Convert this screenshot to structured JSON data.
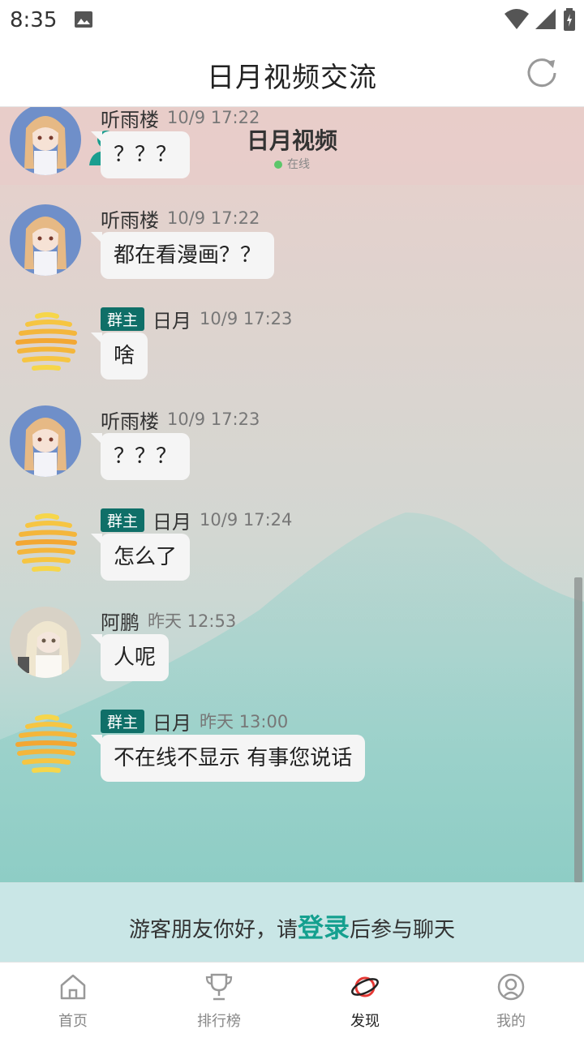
{
  "status": {
    "time": "8:35"
  },
  "header": {
    "title": "日月视频交流"
  },
  "group": {
    "name": "日月视频",
    "status": "在线"
  },
  "messages": [
    {
      "sender": "听雨楼",
      "badge": "",
      "time": "10/9 17:22",
      "text": "？？？",
      "avatar": "anime-girl"
    },
    {
      "sender": "听雨楼",
      "badge": "",
      "time": "10/9 17:22",
      "text": "都在看漫画？？",
      "avatar": "anime-girl"
    },
    {
      "sender": "日月",
      "badge": "群主",
      "time": "10/9 17:23",
      "text": "啥",
      "avatar": "sun-logo"
    },
    {
      "sender": "听雨楼",
      "badge": "",
      "time": "10/9 17:23",
      "text": "？？？",
      "avatar": "anime-girl"
    },
    {
      "sender": "日月",
      "badge": "群主",
      "time": "10/9 17:24",
      "text": "怎么了",
      "avatar": "sun-logo"
    },
    {
      "sender": "阿鹏",
      "badge": "",
      "time": "昨天 12:53",
      "text": "人呢",
      "avatar": "anime-girl-white"
    },
    {
      "sender": "日月",
      "badge": "群主",
      "time": "昨天 13:00",
      "text": "不在线不显示 有事您说话",
      "avatar": "sun-logo"
    }
  ],
  "login": {
    "prefix": "游客朋友你好，请",
    "link": "登录",
    "suffix": "后参与聊天"
  },
  "tabs": [
    {
      "label": "首页",
      "icon": "home-icon",
      "active": false
    },
    {
      "label": "排行榜",
      "icon": "trophy-icon",
      "active": false
    },
    {
      "label": "发现",
      "icon": "planet-icon",
      "active": true
    },
    {
      "label": "我的",
      "icon": "profile-icon",
      "active": false
    }
  ],
  "colors": {
    "accent": "#14a08f",
    "badge": "#0f6f68",
    "online": "#5cc66a",
    "active_tab_icon": "#e53935"
  }
}
